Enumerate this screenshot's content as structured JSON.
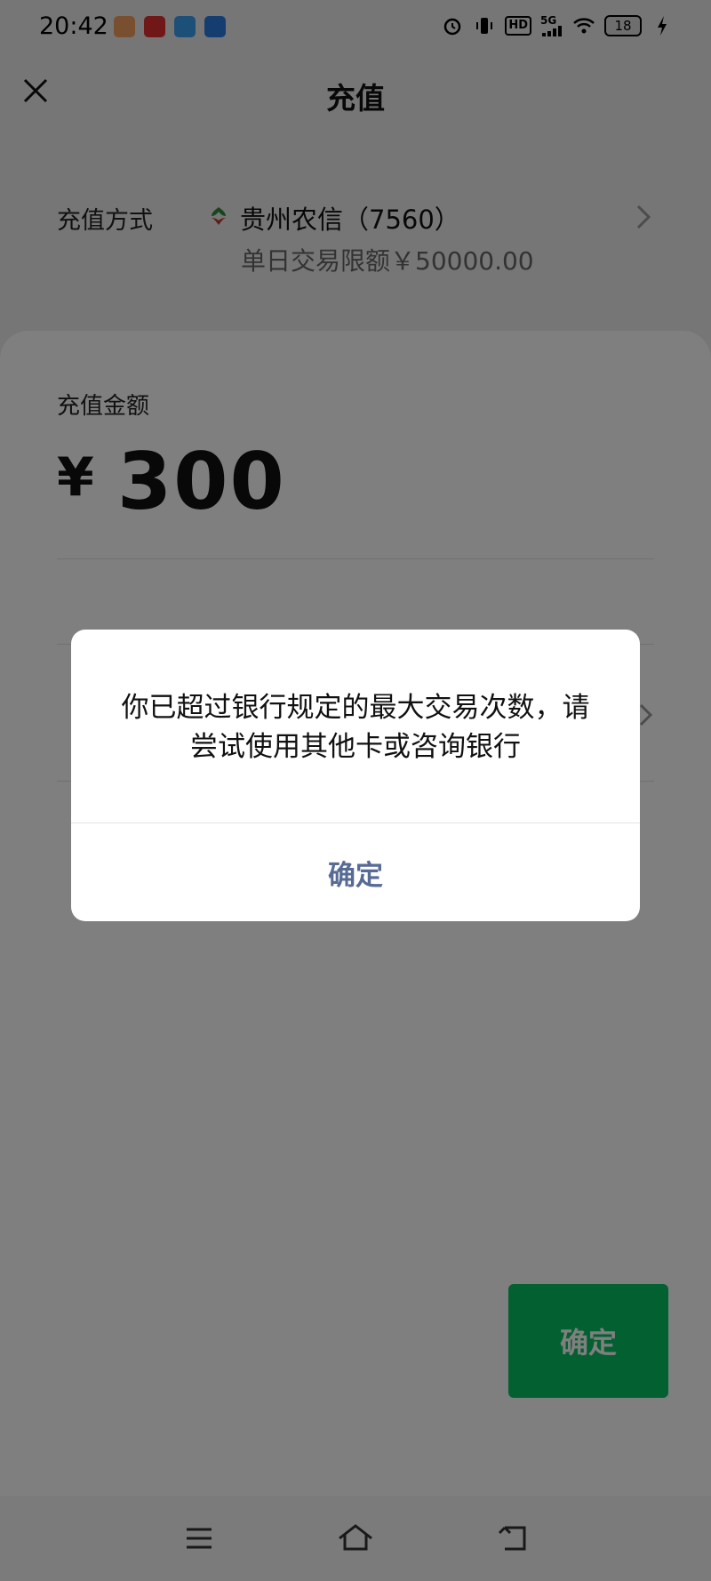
{
  "status_bar": {
    "time": "20:42",
    "network_label": "5G",
    "hd_label": "HD",
    "battery_level": "18",
    "app_icons": [
      "app-icon-1",
      "app-icon-2",
      "app-icon-3",
      "app-icon-4"
    ],
    "system_icons": [
      "alarm-icon",
      "vibrate-icon",
      "hd-icon",
      "signal-icon",
      "wifi-icon",
      "battery-icon",
      "charging-icon"
    ]
  },
  "header": {
    "title": "充值",
    "close_icon": "close-icon"
  },
  "payment_method": {
    "label": "充值方式",
    "bank_name": "贵州农信（7560）",
    "limit_text": "单日交易限额￥50000.00",
    "bank_logo_icon": "bank-logo-icon",
    "chevron_icon": "chevron-right-icon"
  },
  "amount": {
    "label": "充值金额",
    "currency": "¥",
    "value": "300"
  },
  "main_confirm": {
    "label": "确定"
  },
  "dialog": {
    "message": "你已超过银行规定的最大交易次数，请尝试使用其他卡或咨询银行",
    "confirm_label": "确定"
  },
  "bottom_nav": {
    "items": [
      "menu-icon",
      "home-icon",
      "back-icon"
    ]
  },
  "colors": {
    "accent_green": "#07c160",
    "dialog_link": "#576b95",
    "background": "#ededed"
  }
}
